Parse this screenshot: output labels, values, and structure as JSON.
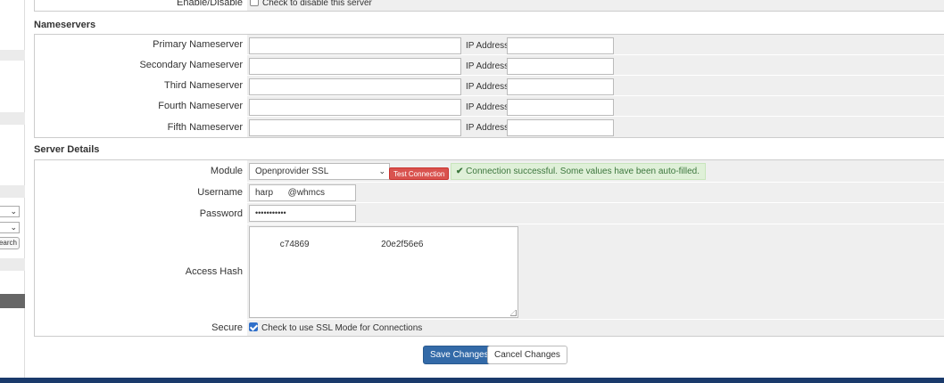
{
  "colors": {
    "primary": "#336aa8",
    "danger": "#d9534f",
    "success_bg": "#dff0d8",
    "success_text": "#3c763d",
    "footer": "#1a3a6b"
  },
  "sidebar": {
    "select1_caret": "⌄",
    "select2_caret": "⌄",
    "search_button": "Search"
  },
  "enable": {
    "label": "Enable/Disable",
    "checkbox_text": "Check to disable this server"
  },
  "nameservers": {
    "title": "Nameservers",
    "ip_label": "IP Address:",
    "rows": [
      {
        "label": "Primary Nameserver",
        "value": "",
        "ip": ""
      },
      {
        "label": "Secondary Nameserver",
        "value": "",
        "ip": ""
      },
      {
        "label": "Third Nameserver",
        "value": "",
        "ip": ""
      },
      {
        "label": "Fourth Nameserver",
        "value": "",
        "ip": ""
      },
      {
        "label": "Fifth Nameserver",
        "value": "",
        "ip": ""
      }
    ]
  },
  "server_details": {
    "title": "Server Details",
    "module_label": "Module",
    "module_value": "Openprovider SSL",
    "test_connection": "Test Connection",
    "success_icon": "check-icon",
    "success_message": "Connection successful. Some values have been auto-filled.",
    "username_label": "Username",
    "username_value": "harp      @whmcs",
    "password_label": "Password",
    "password_value": "•••••••••••",
    "access_hash_label": "Access Hash",
    "access_hash_value": "c74869                             20e2f56e6",
    "secure_label": "Secure",
    "secure_text": "Check to use SSL Mode for Connections"
  },
  "actions": {
    "save": "Save Changes",
    "cancel": "Cancel Changes"
  }
}
